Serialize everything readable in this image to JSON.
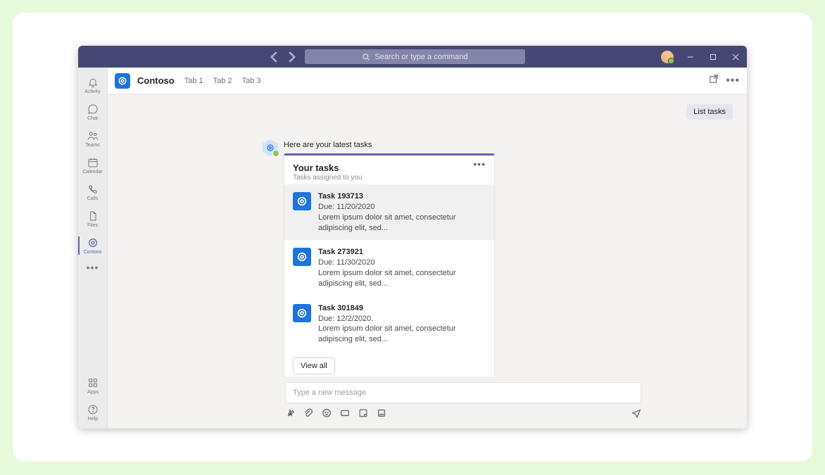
{
  "titlebar": {
    "search_placeholder": "Search or type a command"
  },
  "rail": {
    "items": [
      {
        "id": "activity",
        "label": "Activity"
      },
      {
        "id": "chat",
        "label": "Chat"
      },
      {
        "id": "teams",
        "label": "Teams"
      },
      {
        "id": "calendar",
        "label": "Calendar"
      },
      {
        "id": "calls",
        "label": "Calls"
      },
      {
        "id": "files",
        "label": "Files"
      },
      {
        "id": "contoso",
        "label": "Contoso"
      }
    ],
    "bottom": [
      {
        "id": "apps",
        "label": "Apps"
      },
      {
        "id": "help",
        "label": "Help"
      }
    ]
  },
  "header": {
    "app_name": "Contoso",
    "tabs": [
      "Tab 1",
      "Tab 2",
      "Tab 3"
    ]
  },
  "conversation": {
    "user_message": "List tasks",
    "bot_intro": "Here are your latest tasks",
    "card": {
      "title": "Your tasks",
      "subtitle": "Tasks assigned to you",
      "tasks": [
        {
          "title": "Task 193713",
          "due": "Due: 11/20/2020",
          "desc": "Lorem ipsum dolor sit amet, consectetur adipiscing elit, sed..."
        },
        {
          "title": "Task 273921",
          "due": "Due: 11/30/2020",
          "desc": "Lorem ipsum dolor sit amet, consectetur adipiscing elit, sed..."
        },
        {
          "title": "Task 301849",
          "due": "Due: 12/2/2020.",
          "desc": "Lorem ipsum dolor sit amet, consectetur adipiscing elit, sed..."
        }
      ],
      "action_label": "View all"
    }
  },
  "composer": {
    "placeholder": "Type a new message"
  }
}
